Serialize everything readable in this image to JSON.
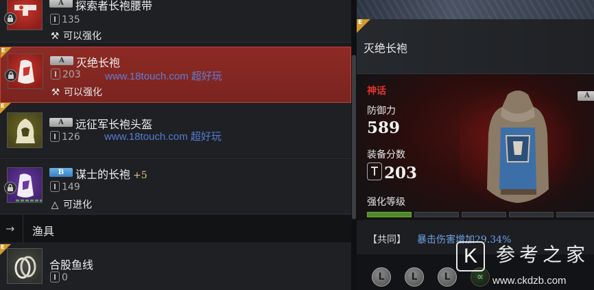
{
  "items": [
    {
      "name": "探索者长袍腰带",
      "grade": "A",
      "score": "135",
      "note": "可以强化",
      "note_icon": "hammer-icon"
    },
    {
      "name": "灭绝长袍",
      "grade": "A",
      "score": "203",
      "note": "可以强化",
      "note_icon": "hammer-icon",
      "selected": true,
      "tier": "E"
    },
    {
      "name": "远征军长袍头盔",
      "grade": "A",
      "score": "126",
      "tier": "E"
    },
    {
      "name": "谋士的长袍",
      "plus": "+5",
      "grade": "B",
      "score": "149",
      "note": "可进化",
      "note_icon": "evolve-icon"
    },
    {
      "name": "合股鱼线",
      "score": "0",
      "tier": "E"
    }
  ],
  "watermark": {
    "site": "www.18touch.com",
    "slogan": "超好玩"
  },
  "section": {
    "title": "渔具"
  },
  "detail": {
    "tier": "E",
    "title": "灭绝长袍",
    "rarity": "神话",
    "grade": "A",
    "defense_label": "防御力",
    "defense_value": "589",
    "score_label": "装备分数",
    "score_value": "203",
    "enhance_label": "强化等级",
    "enhance_level": 1,
    "enhance_max": 5,
    "bonus_tag": "【共同】",
    "bonus_text": "暴击伤害增加29.34%",
    "sockets": [
      "L",
      "L",
      "L",
      "∝"
    ]
  },
  "logo": {
    "letter": "K",
    "name": "参考之家",
    "url": "www.ckdzb.com"
  },
  "colors": {
    "selected_bg": "#8e2a24",
    "rarity": "#e2332c",
    "bonus_text": "#6ea3e2",
    "watermark": "#5c87e6",
    "enhance_on": "#4f8a2a",
    "tier_badge": "#d49a2a"
  }
}
